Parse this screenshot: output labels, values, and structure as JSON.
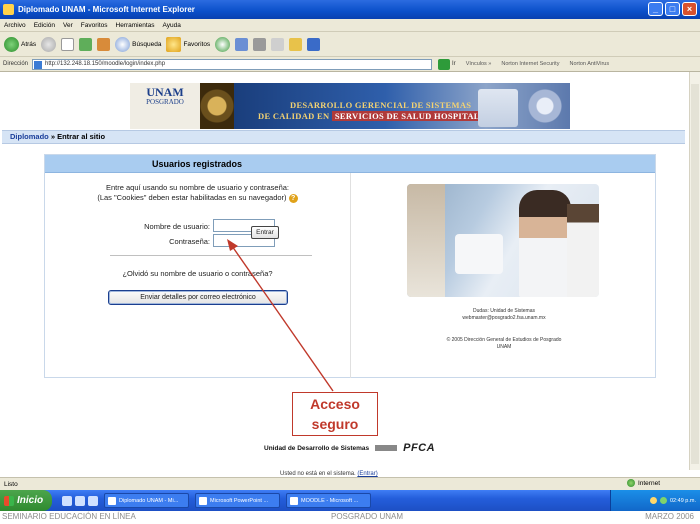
{
  "window": {
    "title": "Diplomado UNAM - Microsoft Internet Explorer",
    "controls": [
      "_",
      "□",
      "×"
    ]
  },
  "menu": [
    "Archivo",
    "Edición",
    "Ver",
    "Favoritos",
    "Herramientas",
    "Ayuda"
  ],
  "toolbar": {
    "back_label": "Atrás",
    "search_label": "Búsqueda",
    "favorites_label": "Favoritos"
  },
  "address": {
    "label": "Dirección",
    "url": "http://132.248.18.150/moodle/login/index.php",
    "go_label": "Ir",
    "links": [
      "Vínculos »",
      "Norton Internet Security",
      "Norton AntiVirus"
    ]
  },
  "banner": {
    "logo_top": "UNAM",
    "logo_sub": "POSGRADO",
    "line1": "DESARROLLO GERENCIAL DE SISTEMAS",
    "line2_prefix": "DE CALIDAD EN ",
    "line2_highlight": "SERVICIOS DE SALUD HOSPITALARIA"
  },
  "breadcrumb": {
    "link": "Diplomado",
    "separator": " » ",
    "current": "Entrar al sitio"
  },
  "login": {
    "header": "Usuarios registrados",
    "instructions_line1": "Entre aquí usando su nombre de usuario y contraseña:",
    "instructions_line2": "(Las \"Cookies\" deben estar habilitadas en su navegador)",
    "help_icon": "?",
    "username_label": "Nombre de usuario:",
    "password_label": "Contraseña:",
    "username_value": "",
    "password_value": "",
    "submit_label": "Entrar",
    "forgot_text": "¿Olvidó su nombre de usuario o contraseña?",
    "send_button": "Enviar detalles por correo electrónico"
  },
  "right_info": {
    "contact_line1": "Dudas: Unidad de Sistemas",
    "contact_line2": "webmaster@posgrado2.fsa.unam.mx",
    "copyright_line1": "© 2005 Dirección General de Estudios de Posgrado",
    "copyright_line2": "UNAM"
  },
  "callout": {
    "line1": "Acceso",
    "line2": "seguro"
  },
  "footer": {
    "unit": "Unidad de Desarrollo de Sistemas",
    "pfca": "PFCA",
    "login_status_prefix": "Usted no está en el sistema. ",
    "login_status_link": "(Entrar)"
  },
  "statusbar": {
    "left": "Listo",
    "zone": "Internet"
  },
  "taskbar": {
    "start": "Inicio",
    "items": [
      "Diplomado UNAM - Mi...",
      "Microsoft PowerPoint ...",
      "MOODLE - Microsoft ..."
    ],
    "clock": "02:49 p.m."
  },
  "slide_footer": {
    "left": "SEMINARIO EDUCACIÓN EN LÍNEA",
    "center": "POSGRADO UNAM",
    "right": "MARZO 2006"
  },
  "colors": {
    "titlebar": "#0a4fc9",
    "login_header": "#a9ccf0",
    "callout": "#c0392b",
    "link": "#1a3e9a"
  }
}
